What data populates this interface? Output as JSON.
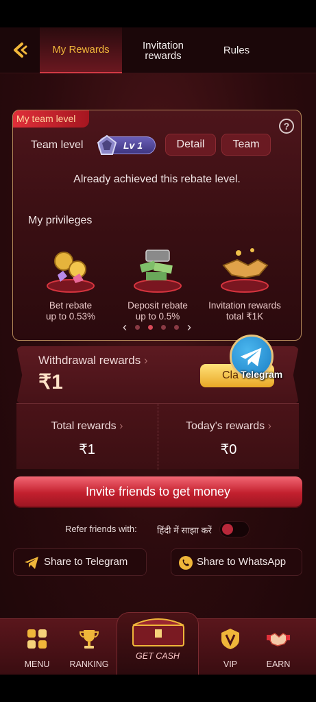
{
  "header": {
    "tabs": [
      {
        "label": "My Rewards",
        "active": true
      },
      {
        "label": "Invitation\nrewards",
        "active": false
      },
      {
        "label": "Rules",
        "active": false
      }
    ]
  },
  "team_card": {
    "tag": "My team level",
    "team_level_label": "Team level",
    "level_badge": "Lv 1",
    "detail_label": "Detail",
    "team_label": "Team",
    "status_text": "Already achieved this rebate level.",
    "privileges_title": "My privileges",
    "privileges": [
      {
        "line1": "Bet rebate",
        "line2": "up to 0.53%"
      },
      {
        "line1": "Deposit rebate",
        "line2": "up to 0.5%"
      },
      {
        "line1": "Invitation rewards",
        "line2": "total ₹1K"
      }
    ],
    "pager": {
      "dots": 4,
      "active_index": 1
    }
  },
  "withdrawal": {
    "title": "Withdrawal rewards",
    "amount": "₹1",
    "claim_label": "Cla",
    "telegram_label": "Telegram"
  },
  "totals": {
    "total_label": "Total rewards",
    "total_value": "₹1",
    "today_label": "Today's rewards",
    "today_value": "₹0"
  },
  "invite": {
    "button_label": "Invite friends to get money",
    "refer_label": "Refer friends with:",
    "language_label": "हिंदी में साझा करें",
    "toggle_on": false
  },
  "share": {
    "telegram_label": "Share to Telegram",
    "whatsapp_label": "Share to WhatsApp"
  },
  "bottom_nav": {
    "items": [
      {
        "label": "MENU"
      },
      {
        "label": "RANKING"
      },
      {
        "label": "GET CASH"
      },
      {
        "label": "VIP"
      },
      {
        "label": "EARN"
      }
    ]
  },
  "colors": {
    "accent_gold": "#f0b63a",
    "primary_red": "#c3202e",
    "background": "#2a0a0d"
  }
}
